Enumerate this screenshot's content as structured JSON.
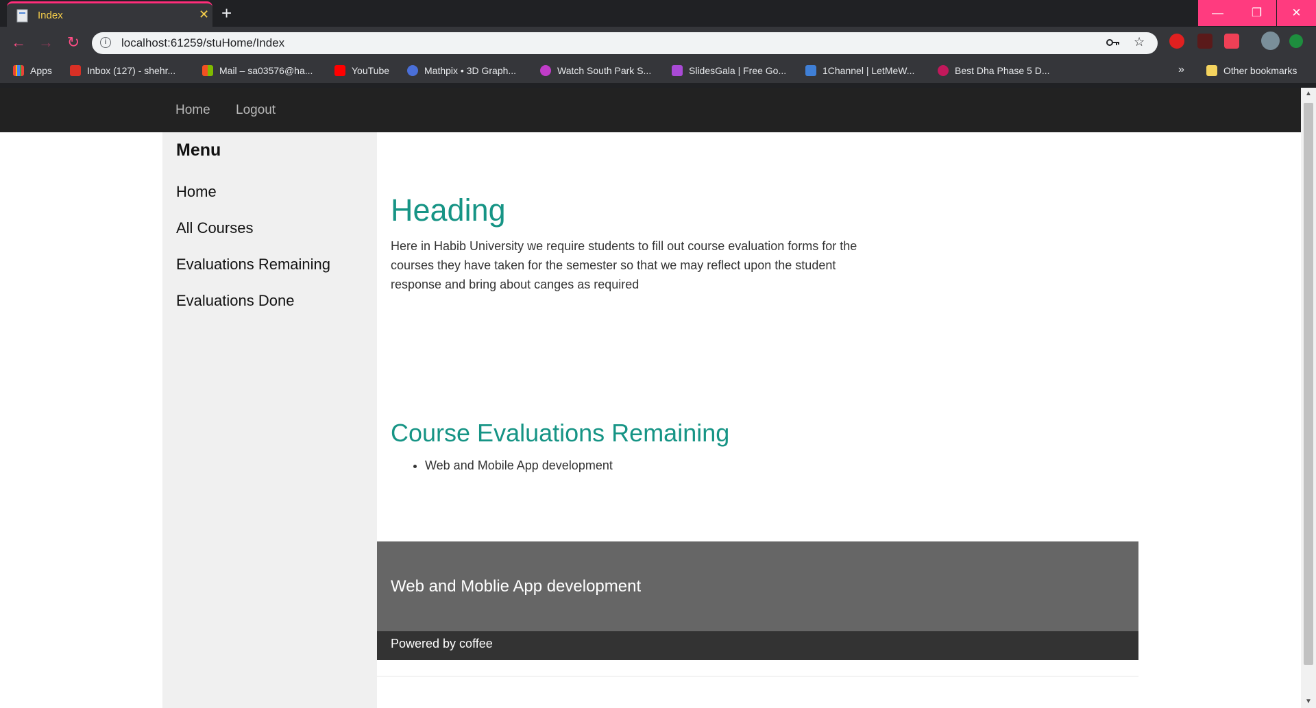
{
  "browser": {
    "tab_title": "Index",
    "tab_close": "✕",
    "new_tab": "+",
    "url": "localhost:61259/stuHome/Index",
    "window": {
      "minimize": "—",
      "restore": "❐",
      "close": "✕"
    },
    "bookmarks": [
      {
        "label": "Apps",
        "color": "#ea4335"
      },
      {
        "label": "Inbox (127) - shehr...",
        "color": "#d93025"
      },
      {
        "label": "Mail – sa03576@ha...",
        "color": "#f25022"
      },
      {
        "label": "YouTube",
        "color": "#ff0000"
      },
      {
        "label": "Mathpix • 3D Graph...",
        "color": "#4a6fd8"
      },
      {
        "label": "Watch South Park S...",
        "color": "#c03cc8"
      },
      {
        "label": "SlidesGala | Free Go...",
        "color": "#a94ad6"
      },
      {
        "label": "1Channel | LetMeW...",
        "color": "#3f7fd6"
      },
      {
        "label": "Best Dha Phase 5 D...",
        "color": "#c2185b"
      }
    ],
    "more_bookmarks": "»",
    "other_bookmarks": "Other bookmarks"
  },
  "nav": {
    "home": "Home",
    "logout": "Logout"
  },
  "sidebar": {
    "title": "Menu",
    "items": [
      "Home",
      "All Courses",
      "Evaluations Remaining",
      "Evaluations Done"
    ]
  },
  "main": {
    "heading": "Heading",
    "intro": "Here in Habib University we require students to fill out course evaluation forms for the courses they have taken for the semester so that we may reflect upon the student response and bring about canges as required",
    "remaining_heading": "Course Evaluations Remaining",
    "remaining_items": [
      "Web and Mobile App development"
    ]
  },
  "footer": {
    "title": "Web and Moblie App development",
    "sub": "Powered by coffee"
  },
  "colors": {
    "accent": "#169485",
    "chrome_accent": "#ff3b7f"
  }
}
